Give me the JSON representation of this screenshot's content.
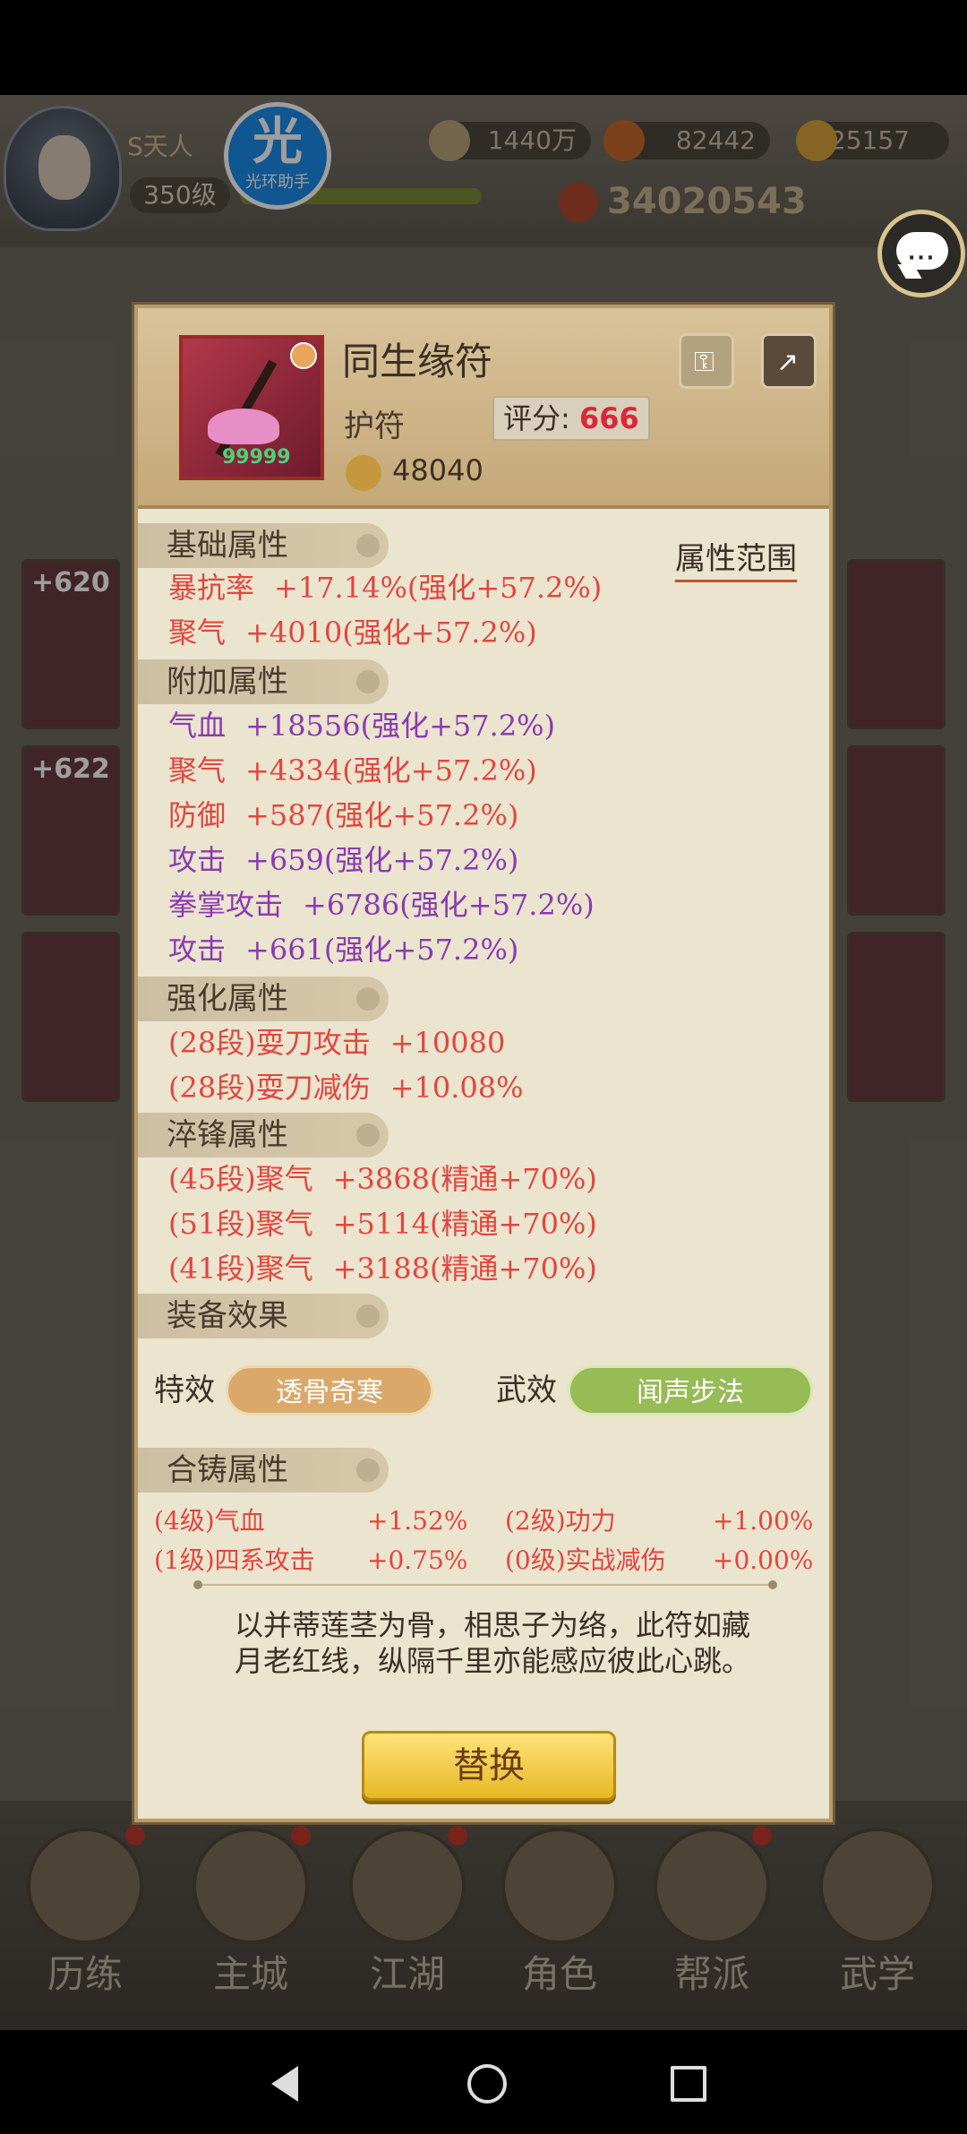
{
  "header": {
    "vip": "S天人",
    "level": "350级",
    "badge": {
      "char": "光",
      "label": "光环助手"
    },
    "resources": {
      "silver": "1440万",
      "gems": "82442",
      "gold": "25157"
    },
    "power": "34020543"
  },
  "item": {
    "name": "同生缘符",
    "type": "护符",
    "score_label": "评分:",
    "score": "666",
    "price": "48040",
    "stars": "99999"
  },
  "sections": {
    "basic": "基础属性",
    "range_link": "属性范围",
    "extra": "附加属性",
    "enhance": "强化属性",
    "temper": "淬锋属性",
    "equip": "装备效果",
    "forge": "合铸属性"
  },
  "basic_attrs": [
    {
      "name": "暴抗率",
      "value": "+17.14%(强化+57.2%)"
    },
    {
      "name": "聚气",
      "value": "+4010(强化+57.2%)"
    }
  ],
  "extra_attrs": [
    {
      "name": "气血",
      "value": "+18556(强化+57.2%)"
    },
    {
      "name": "聚气",
      "value": "+4334(强化+57.2%)"
    },
    {
      "name": "防御",
      "value": "+587(强化+57.2%)"
    },
    {
      "name": "攻击",
      "value": "+659(强化+57.2%)"
    },
    {
      "name": "拳掌攻击",
      "value": "+6786(强化+57.2%)"
    },
    {
      "name": "攻击",
      "value": "+661(强化+57.2%)"
    }
  ],
  "enhance_attrs": [
    {
      "name": "(28段)耍刀攻击",
      "value": "+10080"
    },
    {
      "name": "(28段)耍刀减伤",
      "value": "+10.08%"
    }
  ],
  "temper_attrs": [
    {
      "name": "(45段)聚气",
      "value": "+3868(精通+70%)"
    },
    {
      "name": "(51段)聚气",
      "value": "+5114(精通+70%)"
    },
    {
      "name": "(41段)聚气",
      "value": "+3188(精通+70%)"
    }
  ],
  "effects": {
    "special_label": "特效",
    "special_value": "透骨奇寒",
    "martial_label": "武效",
    "martial_value": "闻声步法"
  },
  "forge_attrs": [
    {
      "name": "(4级)气血",
      "value": "+1.52%"
    },
    {
      "name": "(2级)功力",
      "value": "+1.00%"
    },
    {
      "name": "(1级)四系攻击",
      "value": "+0.75%"
    },
    {
      "name": "(0级)实战减伤",
      "value": "+0.00%"
    }
  ],
  "description": [
    "以并蒂莲茎为骨，相思子为络，此符如藏",
    "月老红线，纵隔千里亦能感应彼此心跳。"
  ],
  "replace_button": "替换",
  "bg_slots": [
    "+620",
    "+622"
  ],
  "bottom_nav": [
    "历练",
    "主城",
    "江湖",
    "角色",
    "帮派",
    "武学"
  ]
}
